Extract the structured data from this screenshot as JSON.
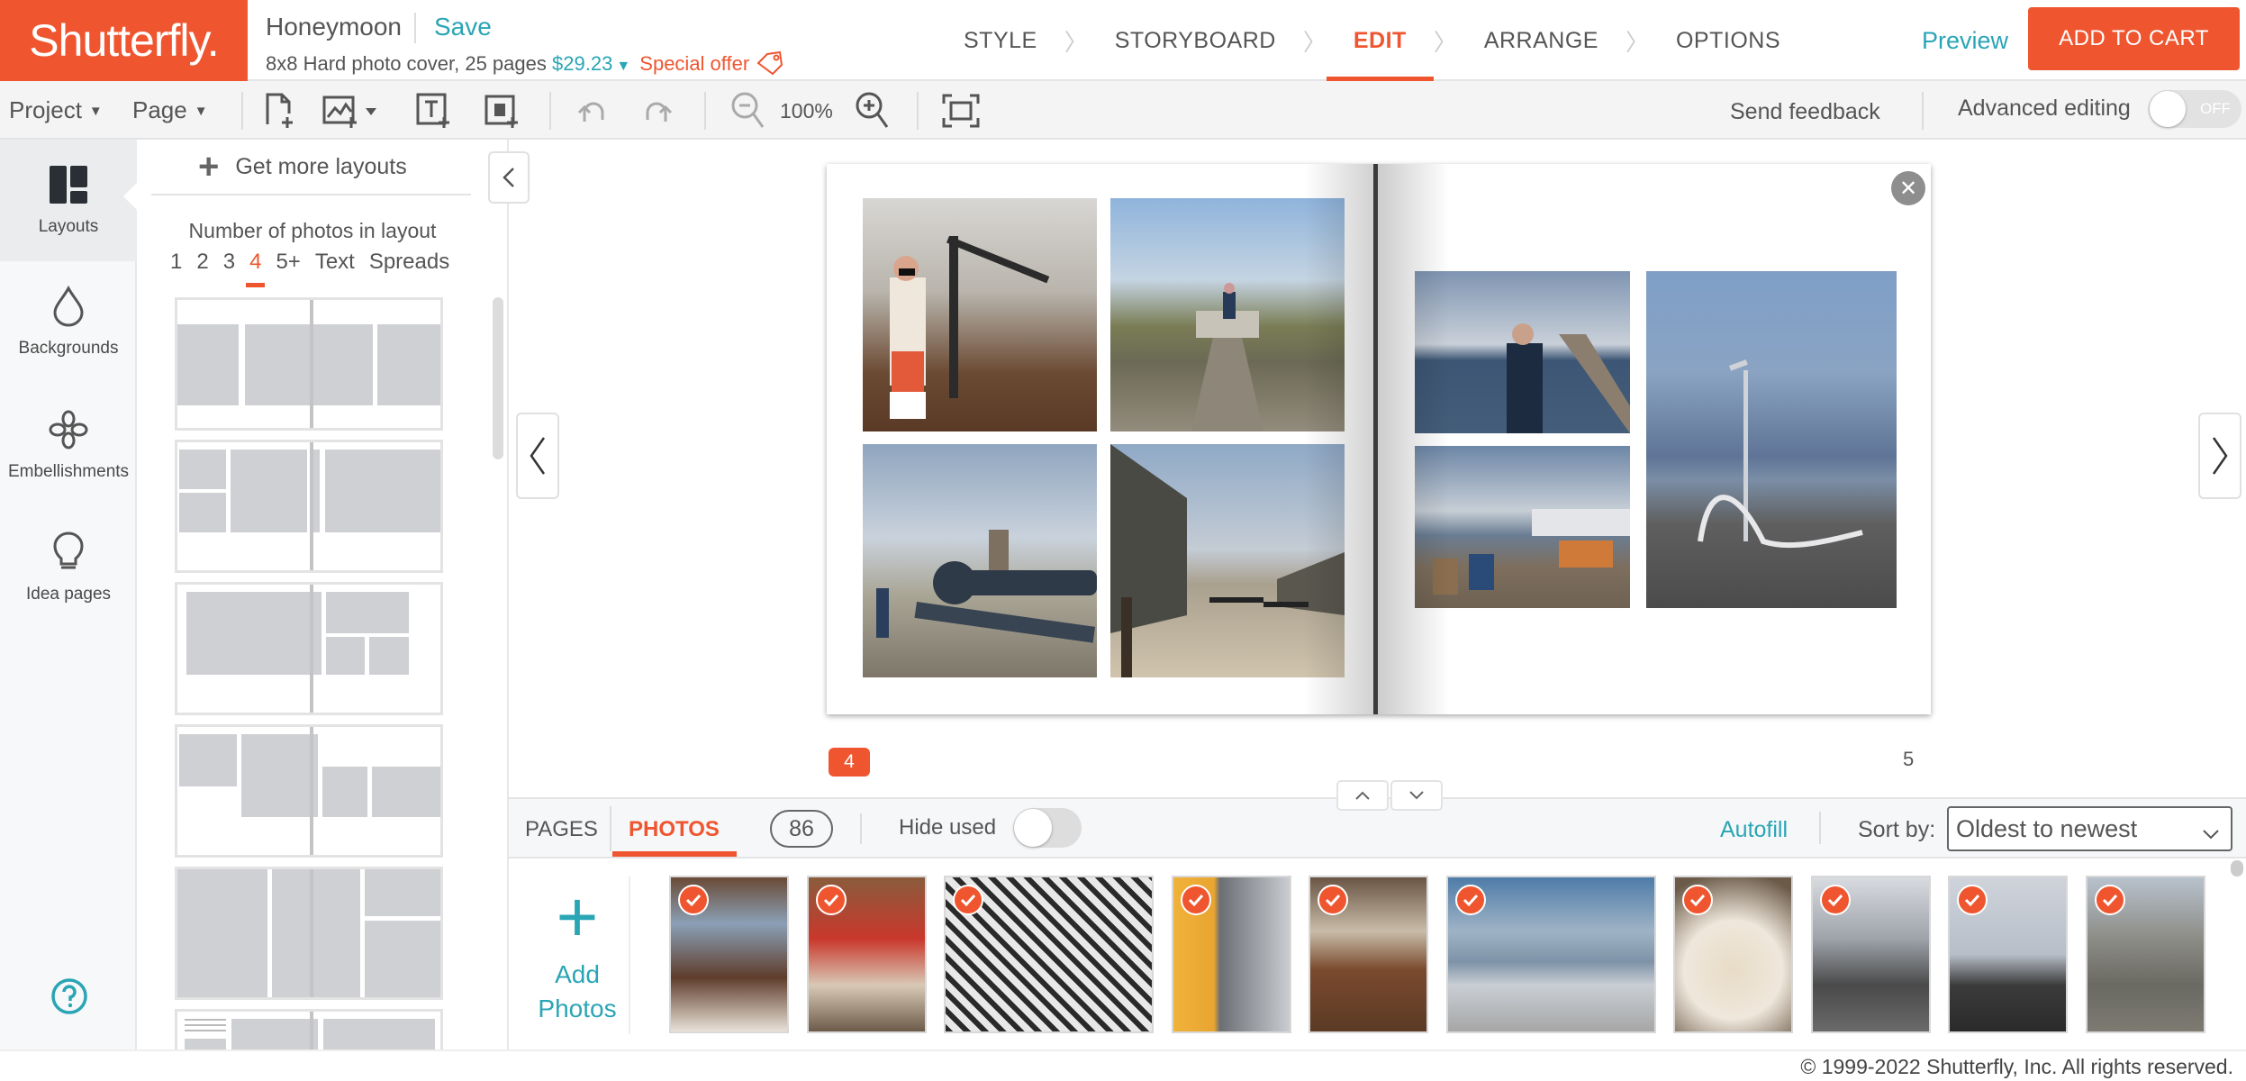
{
  "header": {
    "logo": "Shutterfly.",
    "project_title": "Honeymoon",
    "save_label": "Save",
    "product_desc": "8x8 Hard photo cover, 25 pages",
    "price": "$29.23",
    "special_offer": "Special offer",
    "steps": [
      {
        "label": "STYLE",
        "active": false
      },
      {
        "label": "STORYBOARD",
        "active": false
      },
      {
        "label": "EDIT",
        "active": true
      },
      {
        "label": "ARRANGE",
        "active": false
      },
      {
        "label": "OPTIONS",
        "active": false
      }
    ],
    "preview_label": "Preview",
    "add_to_cart_label": "ADD TO CART"
  },
  "toolbar": {
    "project_menu": "Project",
    "page_menu": "Page",
    "icons": [
      "add-page-icon",
      "add-photo-icon",
      "add-text-icon",
      "add-embellishment-icon",
      "undo-icon",
      "redo-icon",
      "zoom-out-icon",
      "zoom-in-icon",
      "fit-screen-icon"
    ],
    "zoom_level": "100%",
    "send_feedback": "Send feedback",
    "advanced_editing_label": "Advanced editing",
    "advanced_editing_state": "OFF"
  },
  "rail": {
    "items": [
      {
        "label": "Layouts",
        "icon": "layouts-icon",
        "active": true
      },
      {
        "label": "Backgrounds",
        "icon": "droplet-icon",
        "active": false
      },
      {
        "label": "Embellishments",
        "icon": "flower-icon",
        "active": false
      },
      {
        "label": "Idea pages",
        "icon": "lightbulb-icon",
        "active": false
      }
    ],
    "help_icon": "help-icon"
  },
  "layouts_panel": {
    "get_more_label": "Get more layouts",
    "count_label": "Number of photos in layout",
    "count_filters": [
      "1",
      "2",
      "3",
      "4",
      "5+",
      "Text",
      "Spreads"
    ],
    "active_filter": "4"
  },
  "canvas": {
    "left_page_number": "4",
    "right_page_number": "5",
    "left_photos": [
      "museum-room-kilt",
      "boardwalk-dunes",
      "cannon-fort",
      "fort-wall-courtyard"
    ],
    "right_photos": [
      "harbour-pier-man",
      "waterfront-chairs",
      "boardwalk-lamp-sky"
    ]
  },
  "tray": {
    "tab_pages": "PAGES",
    "tab_photos": "PHOTOS",
    "active_tab": "PHOTOS",
    "photo_count": "86",
    "hide_used_label": "Hide used",
    "hide_used_on": false,
    "autofill_label": "Autofill",
    "sort_label": "Sort by:",
    "sort_value": "Oldest to newest",
    "add_photos_line1": "Add",
    "add_photos_line2": "Photos",
    "photos": [
      {
        "desc": "man-at-restaurant-table",
        "used": true
      },
      {
        "desc": "comptoir-gnocchi-sign",
        "used": true
      },
      {
        "desc": "black-white-mural-room",
        "used": true
      },
      {
        "desc": "beer-glass-window",
        "used": true
      },
      {
        "desc": "pizza-boxes-table",
        "used": true
      },
      {
        "desc": "gohabsgo-sign",
        "used": true
      },
      {
        "desc": "pasta-plate",
        "used": true
      },
      {
        "desc": "statue-street",
        "used": true
      },
      {
        "desc": "statue-waterfront",
        "used": true
      },
      {
        "desc": "fort-gate-bridge",
        "used": true
      }
    ]
  },
  "footer": {
    "copyright": "© 1999-2022 Shutterfly, Inc. All rights reserved."
  },
  "colors": {
    "brand_orange": "#ef5630",
    "accent_teal": "#2aa5b5"
  }
}
